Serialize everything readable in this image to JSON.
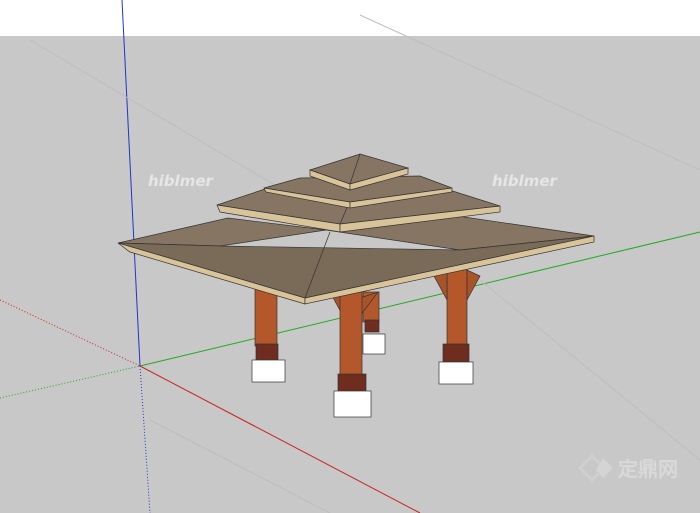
{
  "viewport": {
    "sky_color": "#ffffff",
    "ground_color": "#c8c8c8",
    "axes": {
      "red_axis_color": "#cc2222",
      "green_axis_color": "#22aa22",
      "blue_axis_color": "#2222cc"
    }
  },
  "model": {
    "roof_color": "#857562",
    "roof_edge_color": "#d9c49a",
    "post_color": "#b4582c",
    "bracket_color": "#a8532a",
    "base_color": "#6e2d1e",
    "footing_color": "#ffffff"
  },
  "watermarks": {
    "left": "hiblmer",
    "right": "hiblmer"
  },
  "brand": {
    "icon": "diamond-logo-icon",
    "text": "定鼎网"
  }
}
